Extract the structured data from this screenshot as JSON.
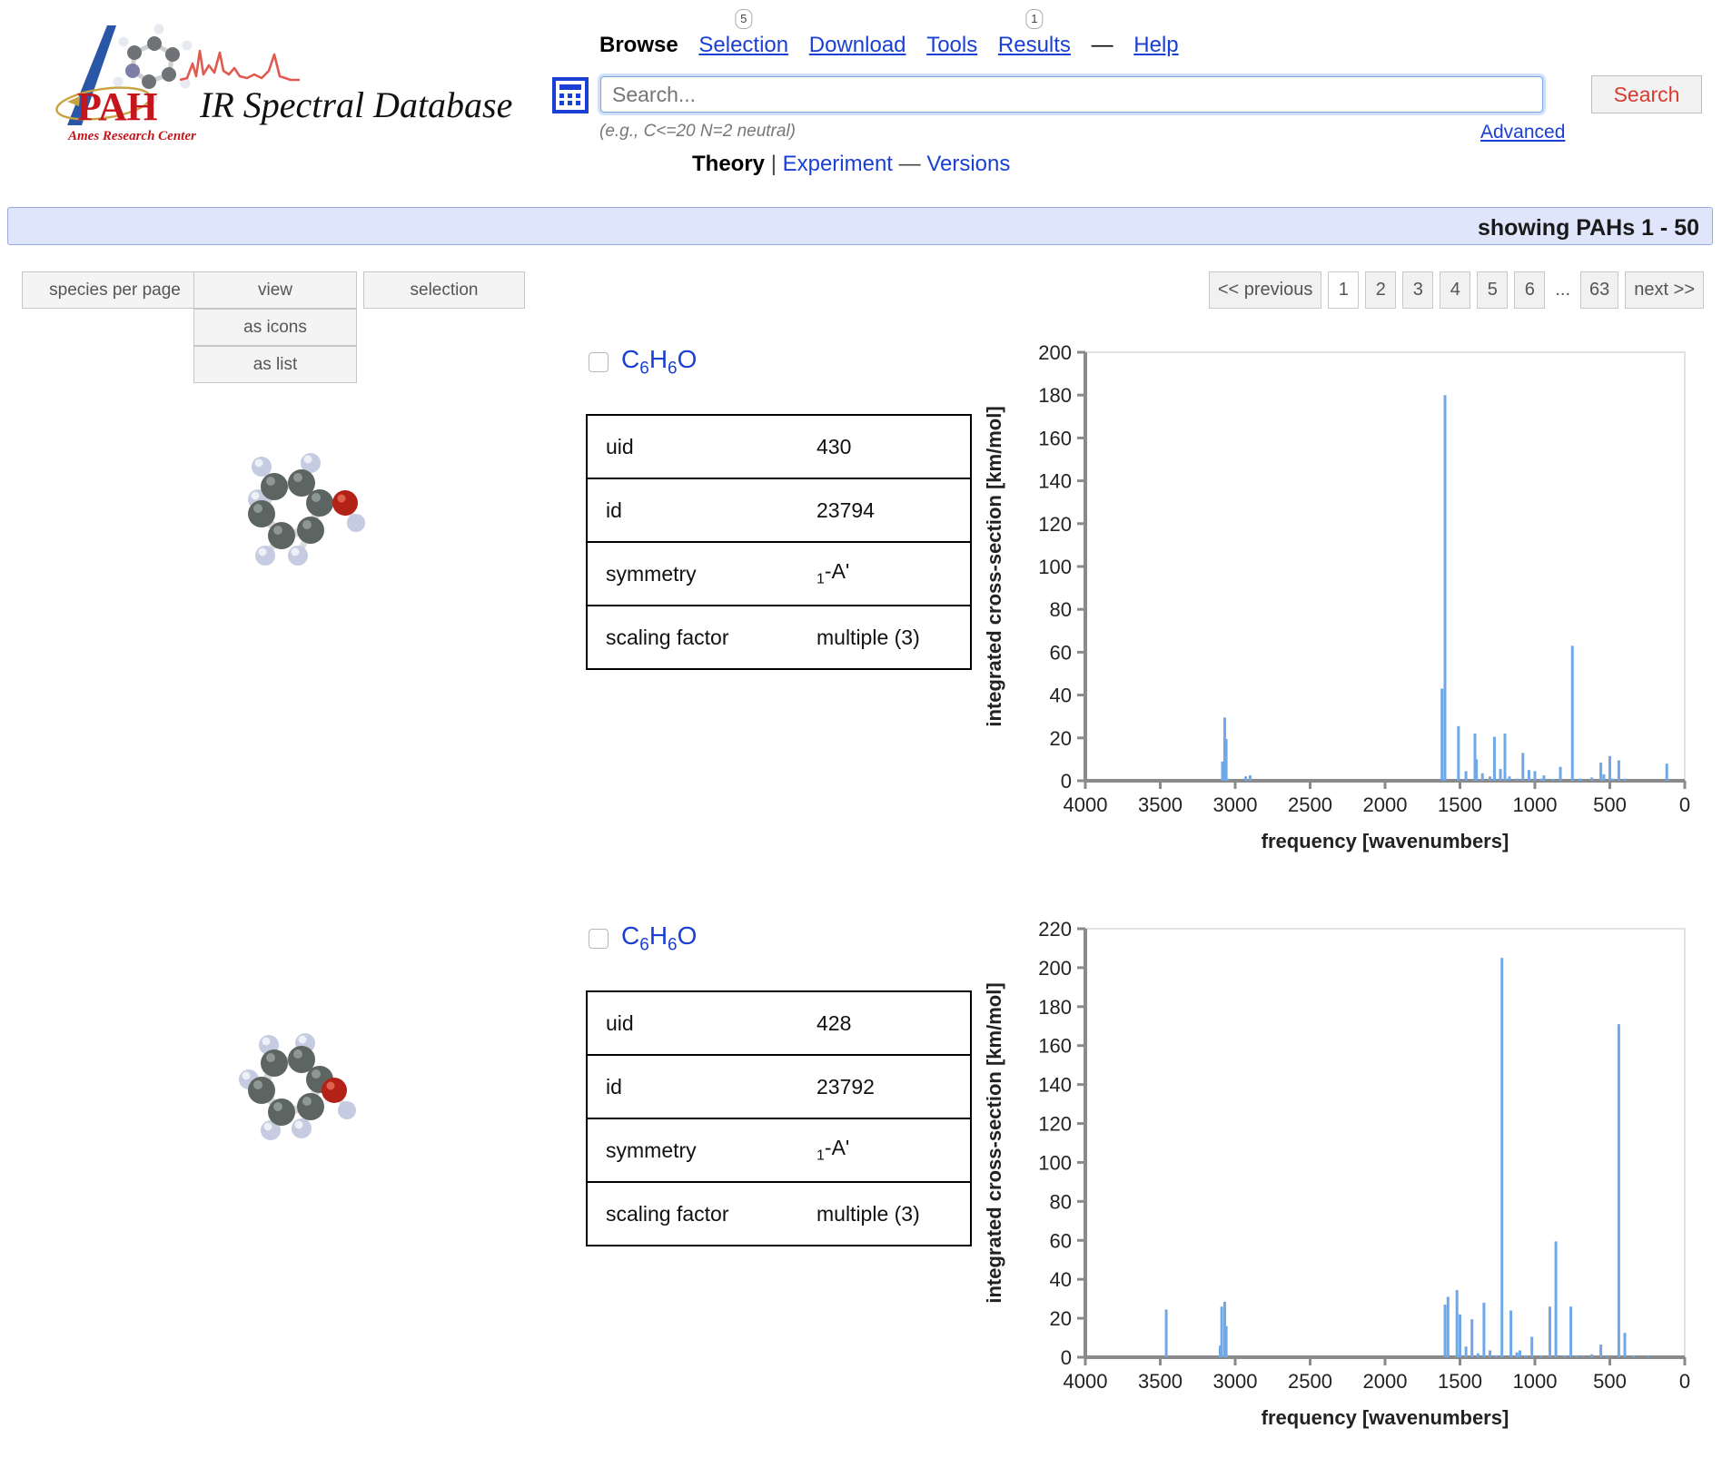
{
  "brand": {
    "pah": "PAH",
    "wordmark": "IR Spectral Database",
    "center": "Ames Research Center"
  },
  "nav": {
    "items": [
      {
        "label": "Browse",
        "current": true,
        "badge": null
      },
      {
        "label": "Selection",
        "current": false,
        "badge": "5"
      },
      {
        "label": "Download",
        "current": false,
        "badge": null
      },
      {
        "label": "Tools",
        "current": false,
        "badge": null
      },
      {
        "label": "Results",
        "current": false,
        "badge": "1"
      }
    ],
    "dash": "—",
    "help": "Help"
  },
  "search": {
    "placeholder": "Search...",
    "value": "",
    "button": "Search",
    "hint": "(e.g., C<=20 N=2 neutral)",
    "advanced": "Advanced",
    "calculator_icon": "calculator-icon"
  },
  "subnav": {
    "theory": "Theory",
    "separator": "|",
    "experiment": "Experiment",
    "dash": "—",
    "versions": "Versions"
  },
  "showing": {
    "text": "showing PAHs 1 - 50"
  },
  "toolbar": {
    "species_per_page": "species per page",
    "view": "view",
    "as_icons": "as icons",
    "as_list": "as list",
    "selection": "selection"
  },
  "pagination": {
    "previous": "<< previous",
    "pages": [
      "1",
      "2",
      "3",
      "4",
      "5",
      "6"
    ],
    "ellipsis": "...",
    "last": "63",
    "next": "next >>",
    "active": "1"
  },
  "table_headers": {
    "uid": "uid",
    "id": "id",
    "symmetry": "symmetry",
    "scaling_factor": "scaling factor"
  },
  "colors": {
    "link": "#1a3fd4",
    "brand_red": "#c4161c",
    "spectrum_blue": "#6fa8e8",
    "bar_background": "#dfe6fb"
  },
  "cards": [
    {
      "formula_parts": [
        {
          "t": "C",
          "sub": false
        },
        {
          "t": "6",
          "sub": true
        },
        {
          "t": "H",
          "sub": false
        },
        {
          "t": "6",
          "sub": true
        },
        {
          "t": "O",
          "sub": false
        }
      ],
      "formula_text": "C6H6O",
      "uid": "430",
      "id": "23794",
      "symmetry_sub": "1",
      "symmetry_rest": "-A'",
      "scaling_factor": "multiple (3)",
      "molecule_alt": "phenol-3d-ball-and-stick-model"
    },
    {
      "formula_parts": [
        {
          "t": "C",
          "sub": false
        },
        {
          "t": "6",
          "sub": true
        },
        {
          "t": "H",
          "sub": false
        },
        {
          "t": "6",
          "sub": true
        },
        {
          "t": "O",
          "sub": false
        }
      ],
      "formula_text": "C6H6O",
      "uid": "428",
      "id": "23792",
      "symmetry_sub": "1",
      "symmetry_rest": "-A'",
      "scaling_factor": "multiple (3)",
      "molecule_alt": "phenol-isomer-3d-ball-and-stick-model"
    }
  ],
  "chart_data": [
    {
      "type": "bar",
      "title": "",
      "xlabel": "frequency [wavenumbers]",
      "ylabel": "integrated cross-section [km/mol]",
      "xlim": [
        4000,
        0
      ],
      "ylim": [
        0,
        200
      ],
      "xticks": [
        4000,
        3500,
        3000,
        2500,
        2000,
        1500,
        1000,
        500,
        0
      ],
      "yticks": [
        0,
        20,
        40,
        60,
        80,
        100,
        120,
        140,
        160,
        180,
        200
      ],
      "x_reversed": true,
      "grid": false,
      "legend": "none",
      "x": [
        3085,
        3070,
        3060,
        3050,
        2930,
        2900,
        1620,
        1600,
        1510,
        1460,
        1400,
        1390,
        1350,
        1300,
        1270,
        1230,
        1200,
        1170,
        1120,
        1080,
        1040,
        1000,
        960,
        940,
        880,
        830,
        750,
        700,
        690,
        620,
        560,
        540,
        500,
        480,
        440,
        400,
        120
      ],
      "values": [
        9.0,
        29.5,
        19.5,
        1.0,
        2.0,
        2.5,
        43.0,
        180.0,
        25.5,
        4.5,
        22.0,
        10.0,
        3.5,
        2.0,
        20.5,
        5.5,
        22.0,
        2.0,
        1.0,
        13.0,
        5.0,
        4.5,
        1.0,
        2.5,
        0.8,
        6.5,
        63.0,
        1.0,
        0.5,
        1.5,
        8.5,
        3.0,
        11.5,
        1.0,
        9.5,
        1.0,
        8.0
      ]
    },
    {
      "type": "bar",
      "title": "",
      "xlabel": "frequency [wavenumbers]",
      "ylabel": "integrated cross-section [km/mol]",
      "xlim": [
        4000,
        0
      ],
      "ylim": [
        0,
        220
      ],
      "xticks": [
        4000,
        3500,
        3000,
        2500,
        2000,
        1500,
        1000,
        500,
        0
      ],
      "yticks": [
        0,
        20,
        40,
        60,
        80,
        100,
        120,
        140,
        160,
        180,
        200,
        220
      ],
      "x_reversed": true,
      "grid": false,
      "legend": "none",
      "x": [
        3460,
        3100,
        3090,
        3070,
        3060,
        1600,
        1580,
        1520,
        1500,
        1460,
        1420,
        1380,
        1340,
        1300,
        1260,
        1220,
        1160,
        1120,
        1100,
        1060,
        1020,
        960,
        900,
        860,
        800,
        760,
        720,
        680,
        620,
        560,
        520,
        440,
        400,
        340,
        240
      ],
      "values": [
        24.5,
        6.0,
        26.0,
        28.5,
        16.0,
        27.0,
        31.0,
        34.5,
        22.0,
        5.5,
        19.5,
        2.0,
        28.0,
        3.5,
        1.0,
        205.0,
        24.0,
        2.5,
        3.5,
        1.0,
        10.5,
        1.0,
        26.0,
        59.5,
        1.0,
        26.0,
        1.0,
        0.5,
        1.5,
        6.5,
        0.5,
        171.0,
        12.5,
        1.0,
        0.5
      ]
    }
  ]
}
